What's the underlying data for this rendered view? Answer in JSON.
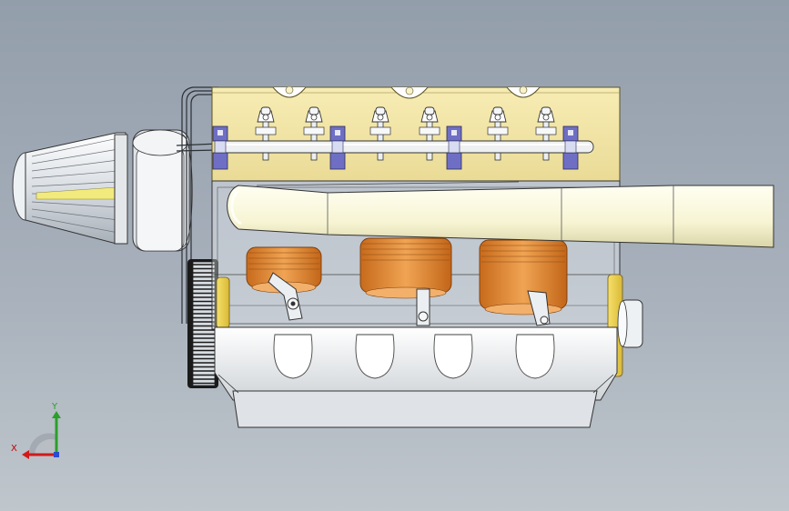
{
  "viewport": {
    "background_top": "#939eab",
    "background_bottom": "#bfc6cc"
  },
  "model": {
    "colors": {
      "head": "#f1e2a0",
      "valve_clip": "#6e6fc4",
      "piston": "#e0913a",
      "pipe": "#fbfadf",
      "block": "#f4f6f8",
      "pan": "#eeeeee"
    }
  },
  "triad": {
    "x_label": "X",
    "y_label": "Y",
    "x_color": "#d11a1a",
    "y_color": "#2aa02a",
    "z_color": "#2a4cd1"
  }
}
